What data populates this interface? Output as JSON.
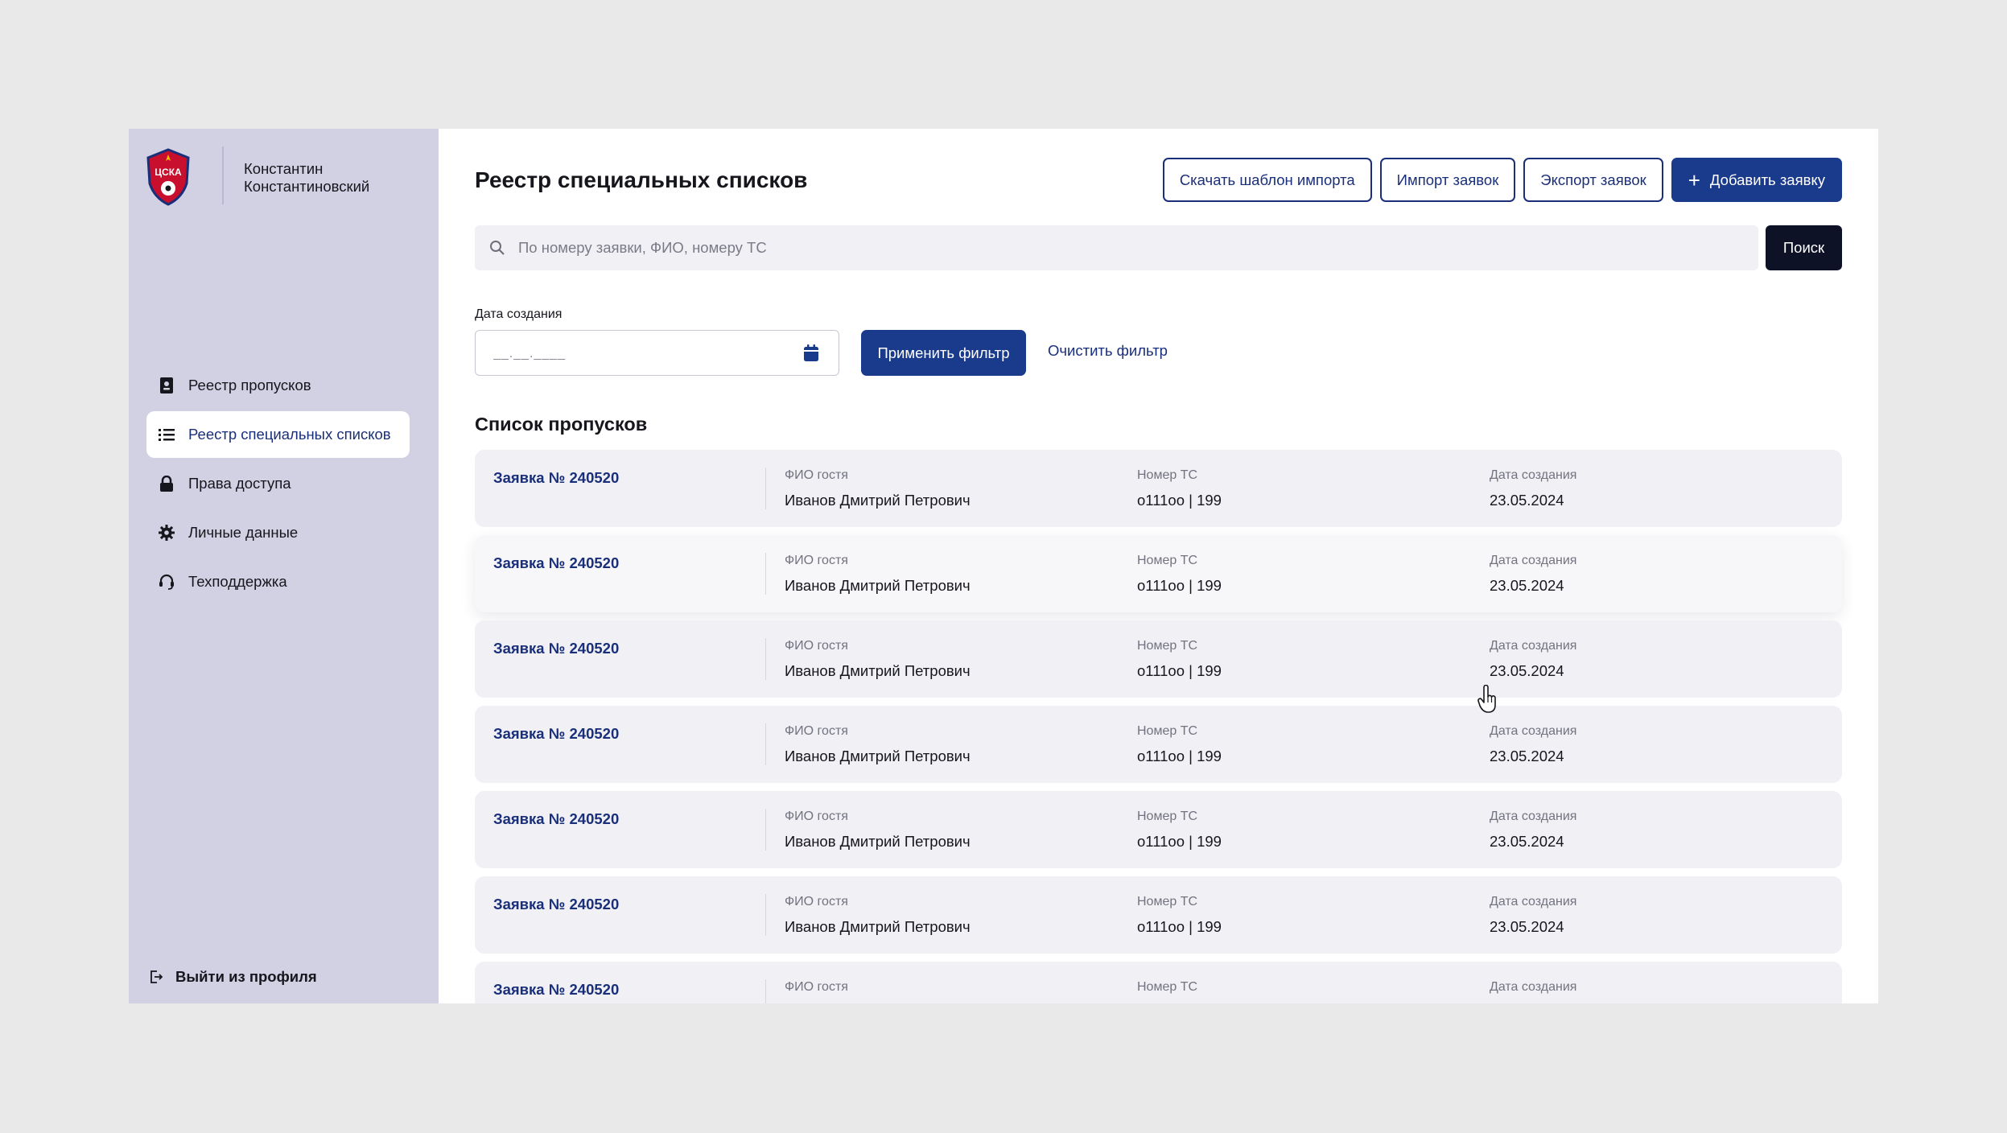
{
  "user": {
    "first_name": "Константин",
    "last_name": "Константиновский"
  },
  "logo": {
    "text": "ЦСКА"
  },
  "sidebar": {
    "items": [
      {
        "label": "Реестр пропусков",
        "icon": "badge-icon",
        "active": false
      },
      {
        "label": "Реестр специальных списков",
        "icon": "list-icon",
        "active": true
      },
      {
        "label": "Права доступа",
        "icon": "lock-icon",
        "active": false
      },
      {
        "label": "Личные данные",
        "icon": "gear-icon",
        "active": false
      },
      {
        "label": "Техподдержка",
        "icon": "headset-icon",
        "active": false
      }
    ],
    "logout_label": "Выйти из профиля"
  },
  "header": {
    "title": "Реестр специальных списков",
    "download_template_label": "Скачать шаблон импорта",
    "import_label": "Импорт заявок",
    "export_label": "Экспорт заявок",
    "add_label": "Добавить заявку"
  },
  "search": {
    "placeholder": "По номеру заявки, ФИО, номеру ТС",
    "value": "",
    "button_label": "Поиск"
  },
  "filter": {
    "date_label": "Дата создания",
    "date_placeholder": "__.__.____",
    "apply_label": "Применить фильтр",
    "clear_label": "Очистить фильтр"
  },
  "list": {
    "title": "Список пропусков",
    "column_labels": {
      "guest": "ФИО гостя",
      "vehicle": "Номер ТС",
      "created": "Дата создания"
    },
    "rows": [
      {
        "request": "Заявка №  240520",
        "guest": "Иванов Дмитрий Петрович",
        "vehicle": "о111оо | 199",
        "created": "23.05.2024"
      },
      {
        "request": "Заявка №  240520",
        "guest": "Иванов Дмитрий Петрович",
        "vehicle": "о111оо | 199",
        "created": "23.05.2024"
      },
      {
        "request": "Заявка №  240520",
        "guest": "Иванов Дмитрий Петрович",
        "vehicle": "о111оо | 199",
        "created": "23.05.2024"
      },
      {
        "request": "Заявка №  240520",
        "guest": "Иванов Дмитрий Петрович",
        "vehicle": "о111оо | 199",
        "created": "23.05.2024"
      },
      {
        "request": "Заявка №  240520",
        "guest": "Иванов Дмитрий Петрович",
        "vehicle": "о111оо | 199",
        "created": "23.05.2024"
      },
      {
        "request": "Заявка №  240520",
        "guest": "Иванов Дмитрий Петрович",
        "vehicle": "о111оо | 199",
        "created": "23.05.2024"
      },
      {
        "request": "Заявка №  240520",
        "guest": "",
        "vehicle": "",
        "created": ""
      }
    ]
  },
  "colors": {
    "accent": "#1a3a8c",
    "sidebar_bg": "#d2d1e3",
    "dark_button": "#0d1226",
    "row_bg": "#f0f0f5"
  }
}
